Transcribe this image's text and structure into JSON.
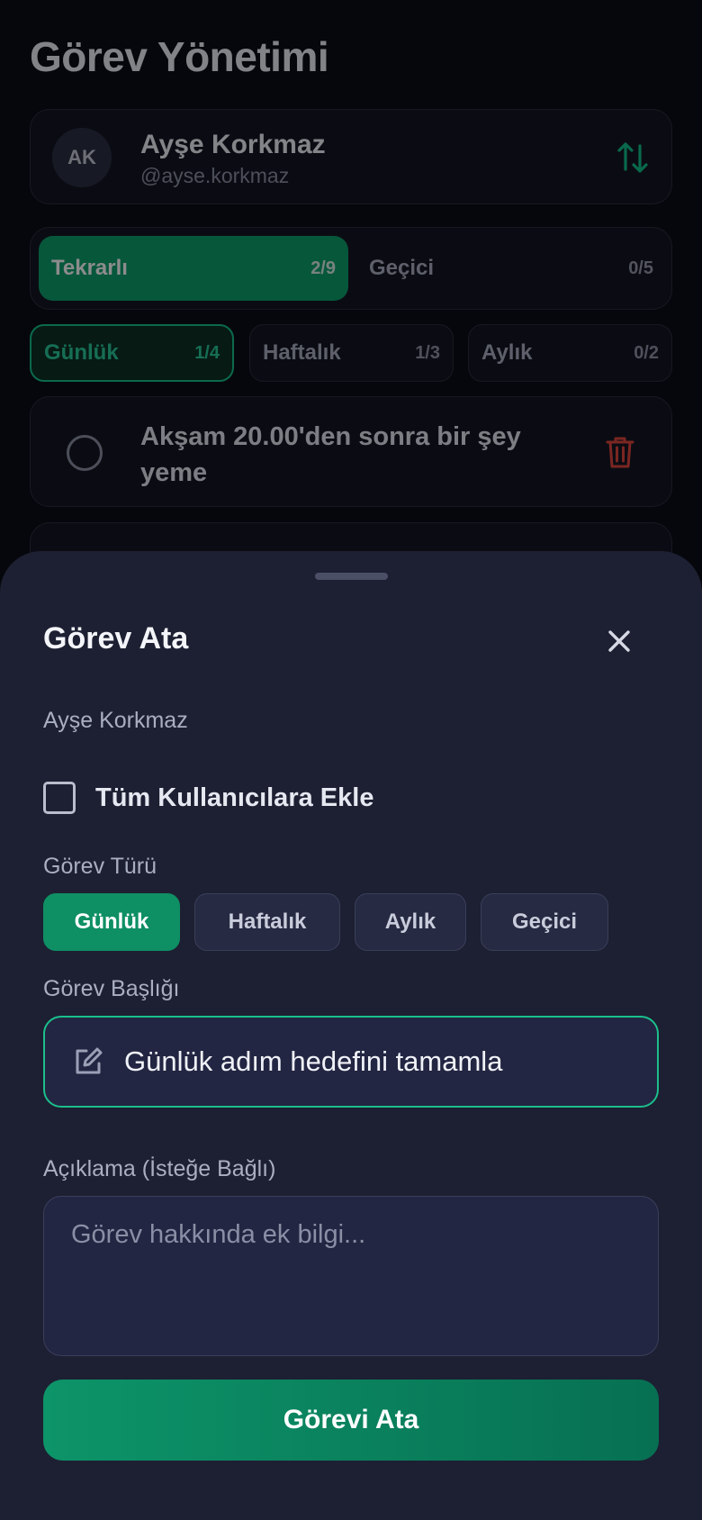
{
  "page": {
    "title": "Görev Yönetimi"
  },
  "user": {
    "initials": "AK",
    "name": "Ayşe Korkmaz",
    "handle": "@ayse.korkmaz"
  },
  "segments": [
    {
      "label": "Tekrarlı",
      "count": "2/9",
      "active": true
    },
    {
      "label": "Geçici",
      "count": "0/5",
      "active": false
    }
  ],
  "period_chips": [
    {
      "label": "Günlük",
      "count": "1/4",
      "active": true
    },
    {
      "label": "Haftalık",
      "count": "1/3",
      "active": false
    },
    {
      "label": "Aylık",
      "count": "0/2",
      "active": false
    }
  ],
  "tasks": [
    {
      "title": "Akşam 20.00'den sonra bir şey yeme"
    }
  ],
  "sheet": {
    "title": "Görev Ata",
    "assignee": "Ayşe Korkmaz",
    "all_users_label": "Tüm Kullanıcılara Ekle",
    "type_label": "Görev Türü",
    "types": [
      {
        "label": "Günlük",
        "active": true
      },
      {
        "label": "Haftalık",
        "active": false
      },
      {
        "label": "Aylık",
        "active": false
      },
      {
        "label": "Geçici",
        "active": false
      }
    ],
    "title_label": "Görev Başlığı",
    "title_value": "Günlük adım hedefini tamamla",
    "description_label": "Açıklama (İsteğe Bağlı)",
    "description_placeholder": "Görev hakkında ek bilgi...",
    "submit_label": "Görevi Ata"
  },
  "colors": {
    "accent": "#0d9e6c",
    "danger": "#e0453f",
    "sheet_bg": "#1d2032",
    "page_bg": "#0b0d16"
  }
}
